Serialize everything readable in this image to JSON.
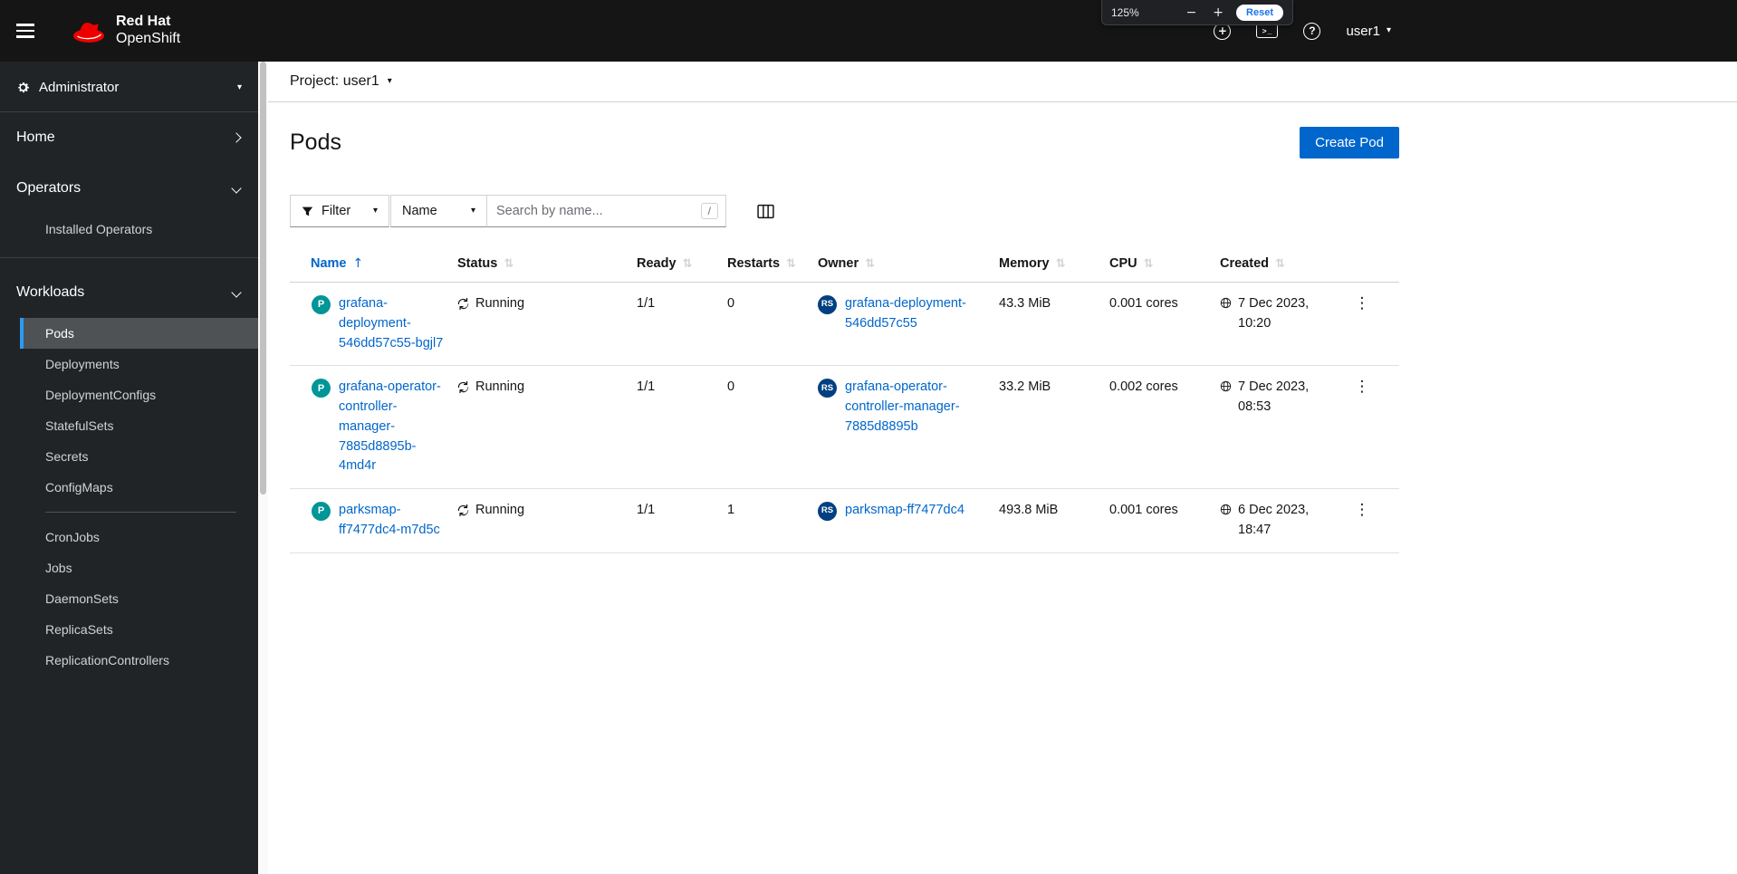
{
  "masthead": {
    "brand_line1": "Red Hat",
    "brand_line2": "OpenShift",
    "user": "user1"
  },
  "zoom_popup": {
    "level": "125%",
    "minus": "−",
    "plus": "+",
    "reset_label": "Reset"
  },
  "sidebar": {
    "perspective": "Administrator",
    "home": "Home",
    "operators": {
      "label": "Operators",
      "items": [
        "Installed Operators"
      ]
    },
    "workloads": {
      "label": "Workloads",
      "items": [
        "Pods",
        "Deployments",
        "DeploymentConfigs",
        "StatefulSets",
        "Secrets",
        "ConfigMaps",
        "CronJobs",
        "Jobs",
        "DaemonSets",
        "ReplicaSets",
        "ReplicationControllers"
      ]
    }
  },
  "project_bar": {
    "label": "Project: user1"
  },
  "page": {
    "title": "Pods",
    "create_button": "Create Pod"
  },
  "toolbar": {
    "filter": "Filter",
    "attribute": "Name",
    "search_placeholder": "Search by name...",
    "shortcut_key": "/"
  },
  "table": {
    "columns": {
      "name": "Name",
      "status": "Status",
      "ready": "Ready",
      "restarts": "Restarts",
      "owner": "Owner",
      "memory": "Memory",
      "cpu": "CPU",
      "created": "Created"
    },
    "rows": [
      {
        "name": "grafana-deployment-546dd57c55-bgjl7",
        "status": "Running",
        "ready": "1/1",
        "restarts": "0",
        "owner": "grafana-deployment-546dd57c55",
        "memory": "43.3 MiB",
        "cpu": "0.001 cores",
        "created": "7 Dec 2023, 10:20"
      },
      {
        "name": "grafana-operator-controller-manager-7885d8895b-4md4r",
        "status": "Running",
        "ready": "1/1",
        "restarts": "0",
        "owner": "grafana-operator-controller-manager-7885d8895b",
        "memory": "33.2 MiB",
        "cpu": "0.002 cores",
        "created": "7 Dec 2023, 08:53"
      },
      {
        "name": "parksmap-ff7477dc4-m7d5c",
        "status": "Running",
        "ready": "1/1",
        "restarts": "1",
        "owner": "parksmap-ff7477dc4",
        "memory": "493.8 MiB",
        "cpu": "0.001 cores",
        "created": "6 Dec 2023, 18:47"
      }
    ]
  },
  "badges": {
    "pod": "P",
    "replica_set": "RS"
  },
  "icons": {
    "kebab": "⋮",
    "sort": "⇅",
    "sort_asc": "↑",
    "caret": "▾",
    "terminal": ">_",
    "help": "?",
    "add": "+"
  },
  "colors": {
    "accent": "#0066cc",
    "pod_badge": "#009596",
    "rs_badge": "#004080",
    "link": "#0066cc"
  }
}
